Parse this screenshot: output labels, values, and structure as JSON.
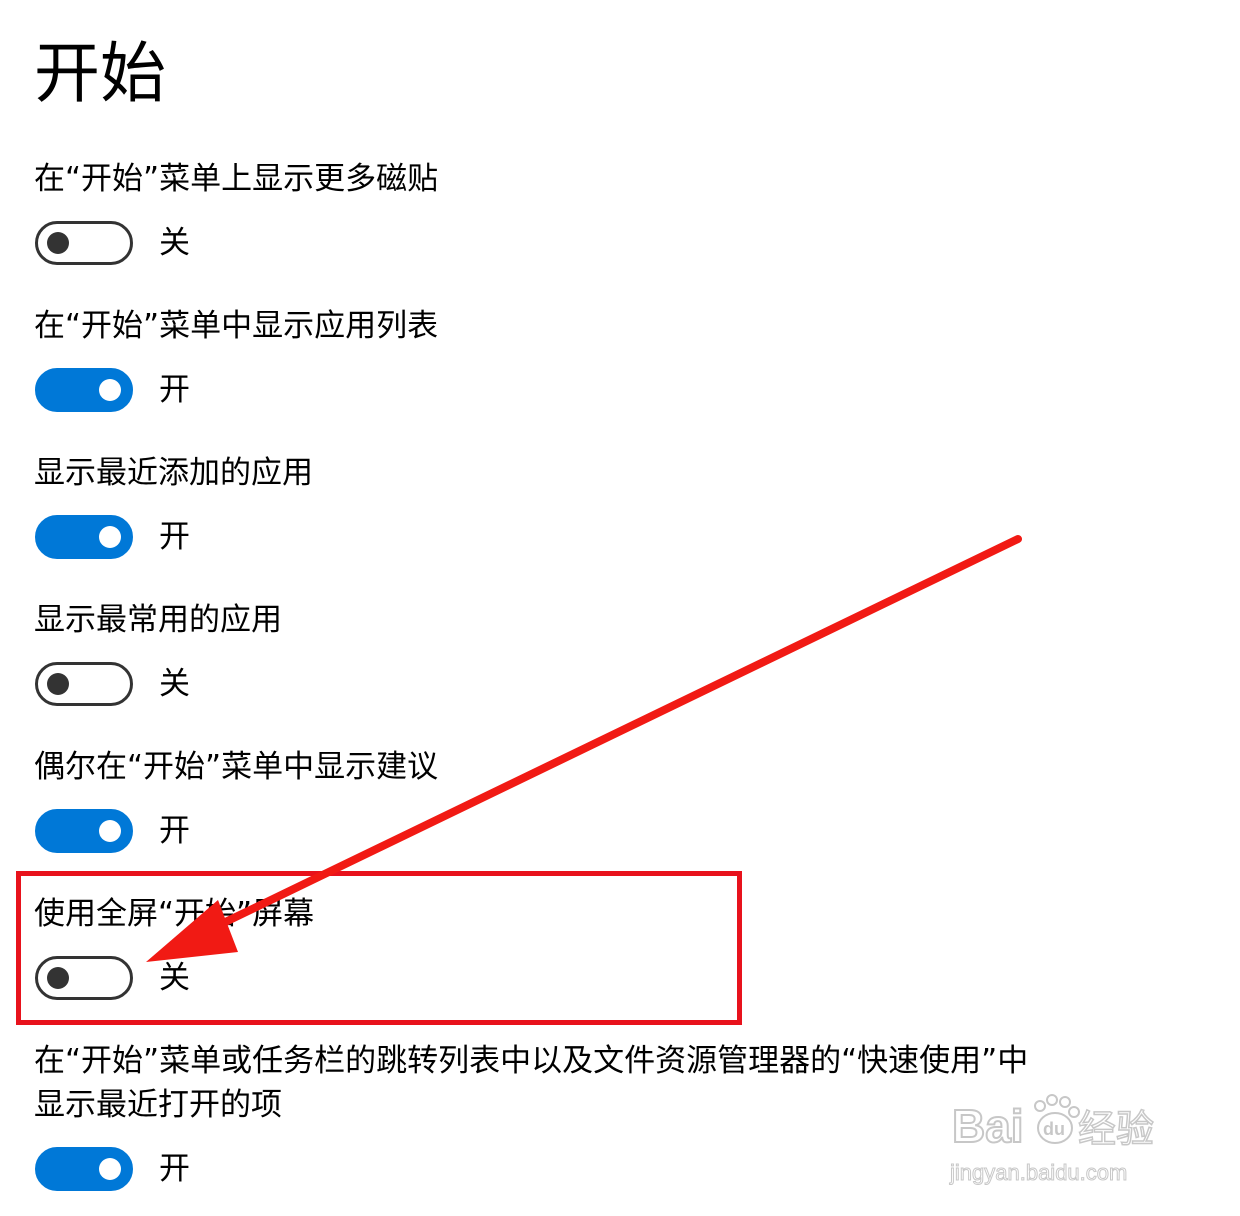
{
  "page": {
    "title": "开始"
  },
  "settings": [
    {
      "label": "在“开始”菜单上显示更多磁贴",
      "state": "关",
      "on": false
    },
    {
      "label": "在“开始”菜单中显示应用列表",
      "state": "开",
      "on": true
    },
    {
      "label": "显示最近添加的应用",
      "state": "开",
      "on": true
    },
    {
      "label": "显示最常用的应用",
      "state": "关",
      "on": false
    },
    {
      "label": "偶尔在“开始”菜单中显示建议",
      "state": "开",
      "on": true
    },
    {
      "label": "使用全屏“开始”屏幕",
      "state": "关",
      "on": false
    },
    {
      "label_line1": "在“开始”菜单或任务栏的跳转列表中以及文件资源管理器的“快速使用”中",
      "label_line2": "显示最近打开的项",
      "state": "开",
      "on": true
    }
  ],
  "annotation": {
    "highlight_color": "#e8121c",
    "arrow_color": "#f11a14"
  },
  "colors": {
    "toggle_on": "#0078d7",
    "toggle_off_border": "#333333",
    "background": "#ffffff"
  },
  "watermark": {
    "brand": "Baidu经验",
    "url": "jingyan.baidu.com"
  }
}
